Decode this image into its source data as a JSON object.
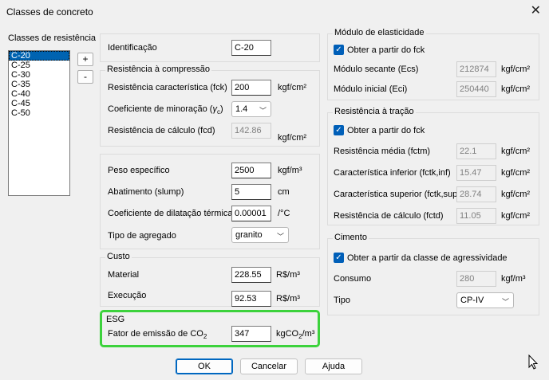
{
  "window": {
    "title": "Classes de concreto",
    "close_label": "✕"
  },
  "classes": {
    "label": "Classes de resistência",
    "items": [
      "C-20",
      "C-25",
      "C-30",
      "C-35",
      "C-40",
      "C-45",
      "C-50"
    ],
    "selected": "C-20",
    "add_label": "+",
    "remove_label": "-"
  },
  "identificacao": {
    "label": "Identificação",
    "value": "C-20"
  },
  "compressao": {
    "title": "Resistência à compressão",
    "fck_label": "Resistência característica (fck)",
    "fck_value": "200",
    "fck_unit": "kgf/cm²",
    "gamma_label_pre": "Coeficiente de minoração (",
    "gamma_symbol": "γ",
    "gamma_sub": "c",
    "gamma_label_post": ")",
    "gamma_value": "1.4",
    "fcd_label": "Resistência de cálculo (fcd)",
    "fcd_value": "142.86",
    "fcd_unit": "kgf/cm²"
  },
  "props": {
    "peso_label": "Peso específico",
    "peso_value": "2500",
    "peso_unit": "kgf/m³",
    "slump_label": "Abatimento (slump)",
    "slump_value": "5",
    "slump_unit": "cm",
    "dil_label": "Coeficiente de dilatação térmica",
    "dil_value": "0.00001",
    "dil_unit": "/°C",
    "agregado_label": "Tipo de agregado",
    "agregado_value": "granito"
  },
  "custo": {
    "title": "Custo",
    "material_label": "Material",
    "material_value": "228.55",
    "material_unit": "R$/m³",
    "execucao_label": "Execução",
    "execucao_value": "92.53",
    "execucao_unit": "R$/m³"
  },
  "esg": {
    "title": "ESG",
    "fator_label_pre": "Fator de emissão de CO",
    "fator_label_sub": "2",
    "fator_value": "347",
    "unit_pre": "kgCO",
    "unit_sub": "2",
    "unit_post": "/m³",
    "highlight_color": "#3cd23c"
  },
  "modulo": {
    "title": "Módulo de elasticidade",
    "checkbox_label": "Obter a partir do fck",
    "ecs_label": "Módulo secante (Ecs)",
    "ecs_value": "212874",
    "ecs_unit": "kgf/cm²",
    "eci_label": "Módulo inicial (Eci)",
    "eci_value": "250440",
    "eci_unit": "kgf/cm²"
  },
  "tracao": {
    "title": "Resistência à tração",
    "checkbox_label": "Obter a partir do fck",
    "fctm_label": "Resistência média (fctm)",
    "fctm_value": "22.1",
    "fctm_unit": "kgf/cm²",
    "fctkinf_label": "Característica inferior (fctk,inf)",
    "fctkinf_value": "15.47",
    "fctkinf_unit": "kgf/cm²",
    "fctksup_label": "Característica superior (fctk,sup)",
    "fctksup_value": "28.74",
    "fctksup_unit": "kgf/cm²",
    "fctd_label": "Resistência de cálculo (fctd)",
    "fctd_value": "11.05",
    "fctd_unit": "kgf/cm²"
  },
  "cimento": {
    "title": "Cimento",
    "checkbox_label": "Obter a partir da classe de agressividade",
    "consumo_label": "Consumo",
    "consumo_value": "280",
    "consumo_unit": "kgf/m³",
    "tipo_label": "Tipo",
    "tipo_value": "CP-IV"
  },
  "buttons": {
    "ok": "OK",
    "cancel": "Cancelar",
    "help": "Ajuda"
  },
  "colors": {
    "accent": "#005fb8",
    "selection": "#0063b1"
  }
}
